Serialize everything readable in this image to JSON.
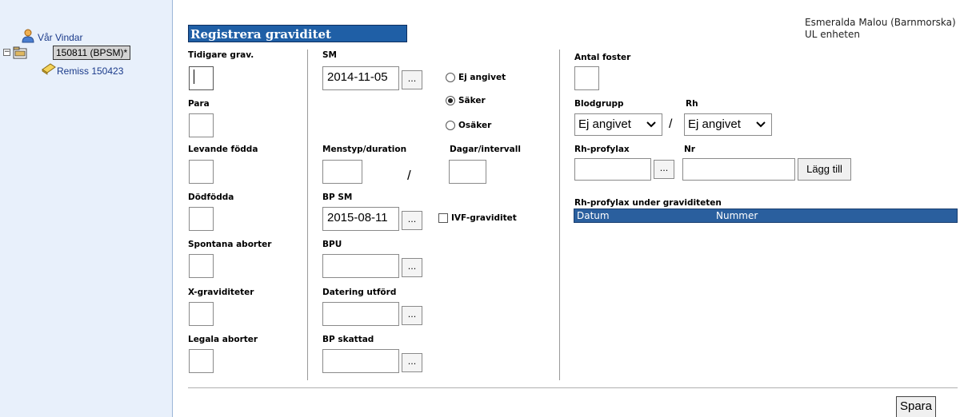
{
  "sidebar": {
    "user_label": "Vår Vindar",
    "record_label": "150811 (BPSM)*",
    "remiss_label": "Remiss 150423"
  },
  "header": {
    "user_info": "Esmeralda Malou (Barnmorska)",
    "unit": "UL enheten"
  },
  "form": {
    "title": "Registrera graviditet",
    "col1": {
      "tidigare_grav": "Tidigare grav.",
      "para": "Para",
      "levande_fodda": "Levande födda",
      "dodfodda": "Dödfödda",
      "spontana_aborter": "Spontana aborter",
      "x_graviditeter": "X-graviditeter",
      "legala_aborter": "Legala aborter"
    },
    "col2": {
      "sm_label": "SM",
      "sm_value": "2014-11-05",
      "dots": "...",
      "radio_ej": "Ej angivet",
      "radio_saker": "Säker",
      "radio_osaker": "Osäker",
      "menstyp_label": "Menstyp/duration",
      "slash": "/",
      "dagar_label": "Dagar/intervall",
      "bpsm_label": "BP SM",
      "bpsm_value": "2015-08-11",
      "ivf_label": "IVF-graviditet",
      "bpu_label": "BPU",
      "datering_label": "Datering utförd",
      "bp_skattad_label": "BP skattad"
    },
    "col3": {
      "antal_foster": "Antal foster",
      "blodgrupp_label": "Blodgrupp",
      "blodgrupp_value": "Ej angivet",
      "rh_label": "Rh",
      "rh_value": "Ej angivet",
      "sep": "/",
      "rh_profylax_label": "Rh-profylax",
      "nr_label": "Nr",
      "lagg_till": "Lägg till",
      "table_title": "Rh-profylax under graviditeten",
      "table_col_datum": "Datum",
      "table_col_nummer": "Nummer"
    },
    "save_label": "Spara"
  },
  "colors": {
    "title_bg": "#1f5fa6",
    "sidebar_bg": "#e8f0fb",
    "table_header_bg": "#2a5f9e"
  }
}
